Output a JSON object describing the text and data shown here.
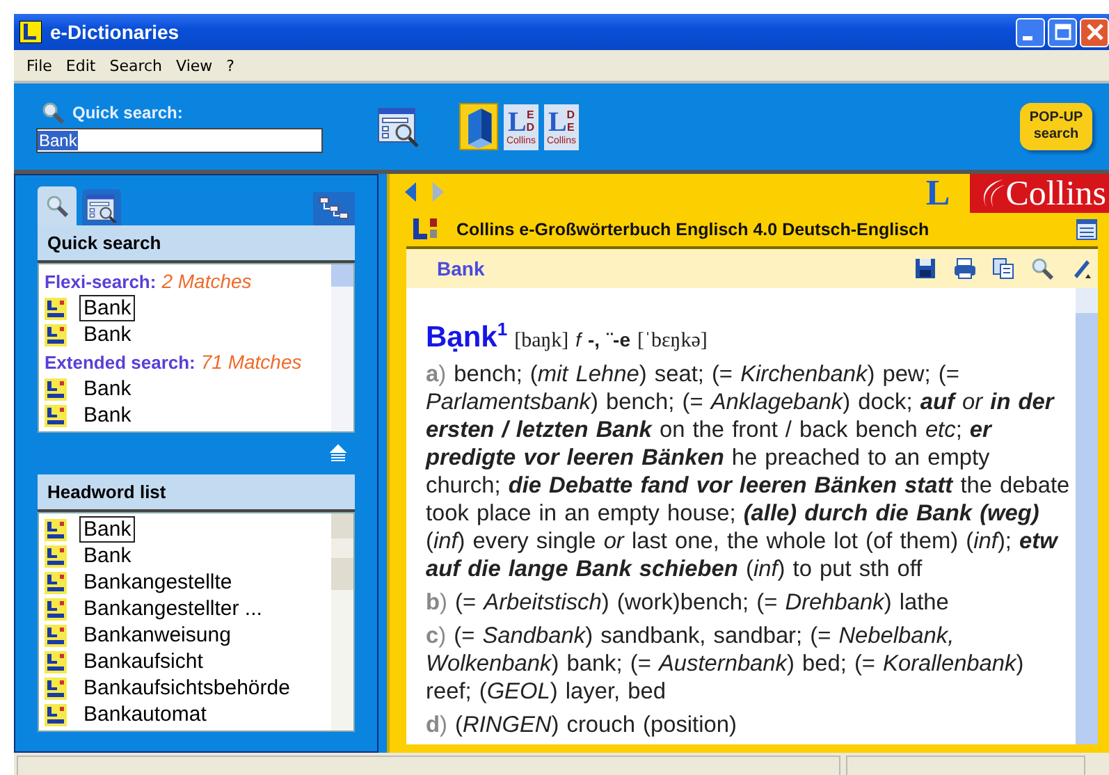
{
  "window": {
    "title": "e-Dictionaries"
  },
  "menu": [
    "File",
    "Edit",
    "Search",
    "View",
    "?"
  ],
  "toolbar": {
    "search_label": "Quick search:",
    "search_value": "Bank",
    "buttons": [
      {
        "kind": "form",
        "selected": false
      },
      {
        "kind": "book",
        "selected": true
      },
      {
        "kind": "dict",
        "selected": false,
        "letter": "L",
        "top": "E",
        "bottom": "D",
        "caption": "Collins"
      },
      {
        "kind": "dict",
        "selected": false,
        "letter": "L",
        "top": "D",
        "bottom": "E",
        "caption": "Collins"
      }
    ],
    "popup": "POP-UP search"
  },
  "left": {
    "tabs": [
      {
        "kind": "search",
        "selected": true
      },
      {
        "kind": "form",
        "selected": false
      }
    ],
    "quick_search": {
      "title": "Quick search",
      "groups": [
        {
          "label": "Flexi-search:",
          "count": "2 Matches",
          "items": [
            {
              "text": "Bank",
              "selected": true
            },
            {
              "text": "Bank",
              "selected": false
            }
          ]
        },
        {
          "label": "Extended search:",
          "count": "71 Matches",
          "items": [
            {
              "text": "Bank",
              "selected": false
            },
            {
              "text": "Bank",
              "selected": false
            }
          ]
        }
      ]
    },
    "headword_list": {
      "title": "Headword list",
      "items": [
        {
          "text": "Bank",
          "selected": true
        },
        {
          "text": "Bank",
          "selected": false
        },
        {
          "text": "Bankangestellte",
          "selected": false
        },
        {
          "text": "Bankangestellter ...",
          "selected": false
        },
        {
          "text": "Bankanweisung",
          "selected": false
        },
        {
          "text": "Bankaufsicht",
          "selected": false
        },
        {
          "text": "Bankaufsichtsbehörde",
          "selected": false
        },
        {
          "text": "Bankautomat",
          "selected": false
        }
      ]
    }
  },
  "right": {
    "nav": [
      {
        "kind": "back",
        "disabled": false
      },
      {
        "kind": "forward",
        "disabled": true
      }
    ],
    "logo": {
      "letter": "L",
      "brand": "Collins"
    },
    "dictionary_title": "Collins e-Großwörterbuch Englisch 4.0 Deutsch-Englisch",
    "entry": {
      "title": "Bank",
      "headword": "Bạnk",
      "homograph": "1",
      "pronunciation": "[baŋk]",
      "grammar": "*f* **-, ¨-e**",
      "pronunciation_plural": "[ˈbɛŋkə]",
      "senses": [
        {
          "label": "**a**)",
          "text": "bench; (*mit Lehne*) seat; (= *Kirchenbank*) pew; (= *Parlamentsbank*) bench; (= *Anklagebank*) dock; **auf** *or* **in der ersten / letzten Bank** on the front / back bench *etc*; **er predigte vor leeren Bänken** he preached to an empty church; **die Debatte fand vor leeren Bänken statt** the debate took place in an empty house; **(alle) durch die Bank (weg)** (*inf*) every single *or* last one, the whole lot (of them) (*inf*); **etw auf die lange Bank schieben** (*inf*) to put sth off"
        },
        {
          "label": "**b**)",
          "text": "(= *Arbeitstisch*) (work)bench; (= *Drehbank*) lathe"
        },
        {
          "label": "**c**)",
          "text": "(= *Sandbank*) sandbank, sandbar; (= *Nebelbank, Wolkenbank*) bank; (= *Austernbank*) bed; (= *Korallenbank*) reef; (*GEOL*) layer, bed"
        },
        {
          "label": "**d**)",
          "text": "(*RINGEN*) crouch (position)"
        }
      ]
    }
  }
}
